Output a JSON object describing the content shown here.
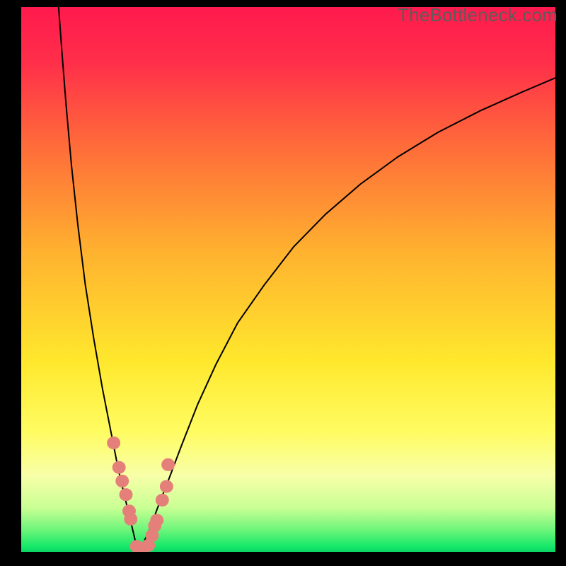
{
  "watermark": "TheBottleneck.com",
  "chart_data": {
    "type": "line",
    "title": "",
    "xlabel": "",
    "ylabel": "",
    "xlim": [
      0,
      100
    ],
    "ylim": [
      0,
      100
    ],
    "background_gradient": {
      "stops": [
        {
          "offset": 0.0,
          "color": "#ff1a4d"
        },
        {
          "offset": 0.1,
          "color": "#ff2e4a"
        },
        {
          "offset": 0.25,
          "color": "#ff6a3a"
        },
        {
          "offset": 0.45,
          "color": "#ffb22f"
        },
        {
          "offset": 0.65,
          "color": "#ffe82d"
        },
        {
          "offset": 0.78,
          "color": "#fffc62"
        },
        {
          "offset": 0.86,
          "color": "#f8ffa8"
        },
        {
          "offset": 0.92,
          "color": "#c8ff94"
        },
        {
          "offset": 0.96,
          "color": "#6cf57a"
        },
        {
          "offset": 0.99,
          "color": "#16e869"
        },
        {
          "offset": 1.0,
          "color": "#0cd664"
        }
      ]
    },
    "series": [
      {
        "name": "left-curve",
        "color": "#000000",
        "stroke_width": 2,
        "x": [
          7.0,
          7.6,
          8.4,
          9.4,
          10.6,
          12.0,
          13.6,
          15.2,
          16.8,
          18.2,
          19.4,
          20.4,
          21.0,
          21.4,
          21.8,
          22.0
        ],
        "y": [
          100.0,
          92.0,
          82.0,
          71.0,
          60.0,
          49.0,
          39.0,
          30.0,
          22.0,
          15.0,
          10.0,
          6.0,
          3.5,
          1.8,
          0.6,
          0.0
        ]
      },
      {
        "name": "right-curve",
        "color": "#000000",
        "stroke_width": 2,
        "x": [
          22.0,
          22.8,
          24.0,
          25.5,
          27.5,
          30.0,
          33.0,
          36.5,
          40.5,
          45.5,
          51.0,
          57.0,
          63.5,
          70.5,
          78.0,
          86.0,
          94.0,
          100.0
        ],
        "y": [
          0.0,
          1.5,
          4.0,
          8.0,
          13.0,
          19.5,
          27.0,
          34.5,
          42.0,
          49.0,
          56.0,
          62.0,
          67.5,
          72.5,
          77.0,
          81.0,
          84.5,
          87.0
        ]
      }
    ],
    "scatter": [
      {
        "name": "points",
        "color": "#e48079",
        "radius": 9,
        "x": [
          17.3,
          18.3,
          18.9,
          19.6,
          20.2,
          20.5,
          21.6,
          22.6,
          23.8,
          24.5,
          25.0,
          25.4,
          26.4,
          27.2,
          27.5
        ],
        "y": [
          20.0,
          15.5,
          13.0,
          10.5,
          7.5,
          6.0,
          1.0,
          0.6,
          1.2,
          3.0,
          4.8,
          5.8,
          9.5,
          12.0,
          16.0
        ]
      }
    ]
  }
}
